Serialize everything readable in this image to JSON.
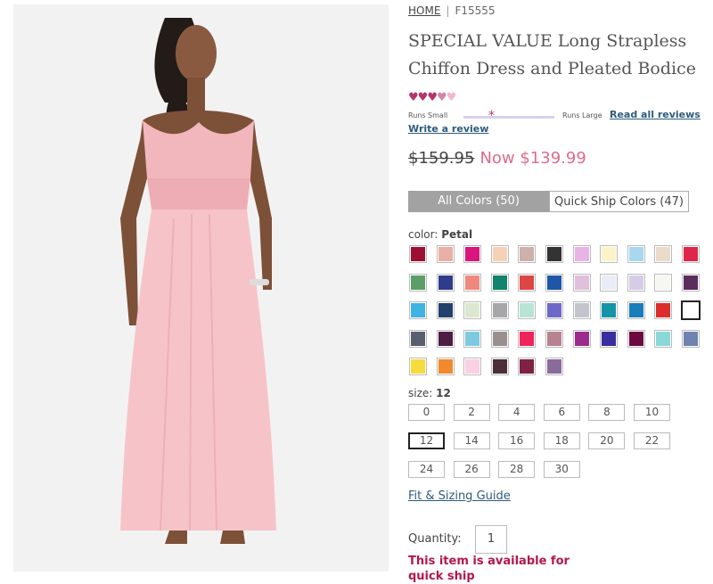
{
  "breadcrumb": {
    "home": "HOME",
    "separator": "|",
    "sku": "F15555"
  },
  "product": {
    "title": "SPECIAL VALUE Long Strapless Chiffon Dress and Pleated Bodice",
    "rating": 3.5,
    "rating_max": 5,
    "fit_small": "Runs Small",
    "fit_large": "Runs Large",
    "fit_marker": "*",
    "read_reviews": "Read all reviews",
    "write_review": "Write a review",
    "price_old": "$159.95",
    "price_now": "Now $139.99"
  },
  "tabs": {
    "all_colors": "All Colors (50)",
    "quick_ship": "Quick Ship Colors (47)"
  },
  "color": {
    "label": "color:",
    "selected": "Petal",
    "swatches": [
      [
        "#9c1133",
        "#e9b0a6",
        "#d8167e",
        "#f7d0b8",
        "#cdb0aa",
        "#333333",
        "#e8b4e6",
        "#fdf3c9",
        "#a8d8ef",
        "#eadbcb",
        "#e0254c"
      ],
      [
        "#5c9e67",
        "#2f3b8b",
        "#ef8980",
        "#12836d",
        "#de4646",
        "#1e56a8",
        "#e0c0dc",
        "#e8ecf6",
        "#d6cce6",
        "#f6f6f2",
        "#5a2d5d"
      ],
      [
        "#3fb3e3",
        "#233f6c",
        "#dbe8cf",
        "#a7a6a8",
        "#b8e4d6",
        "#6f67c8",
        "#c2c6cc",
        "#1494a6",
        "#1a7cb8",
        "#dc2d2d",
        "#ffffff"
      ],
      [
        "#5a5f70",
        "#4e1d45",
        "#7ecae0",
        "#9a8f8f",
        "#f0245c",
        "#b88290",
        "#9c2b8e",
        "#3a2f9c",
        "#6a0a3f",
        "#8ad8d8",
        "#6f82b0"
      ],
      [
        "#f7da3c",
        "#f08a2c",
        "#fad0e4",
        "#4b2e38",
        "#7d2244",
        "#8b6b9c"
      ]
    ]
  },
  "size": {
    "label": "size:",
    "selected": "12",
    "rows": [
      [
        "0",
        "2",
        "4",
        "6",
        "8",
        "10"
      ],
      [
        "12",
        "14",
        "16",
        "18",
        "20",
        "22"
      ],
      [
        "24",
        "26",
        "28",
        "30"
      ]
    ]
  },
  "fit_guide": "Fit & Sizing Guide",
  "quantity": {
    "label": "Quantity:",
    "value": "1"
  },
  "availability": "This item is available for quick ship",
  "colors": {
    "accent_pink": "#e06b8b",
    "link_blue": "#2d5b7c",
    "alert_red": "#b3174e"
  }
}
